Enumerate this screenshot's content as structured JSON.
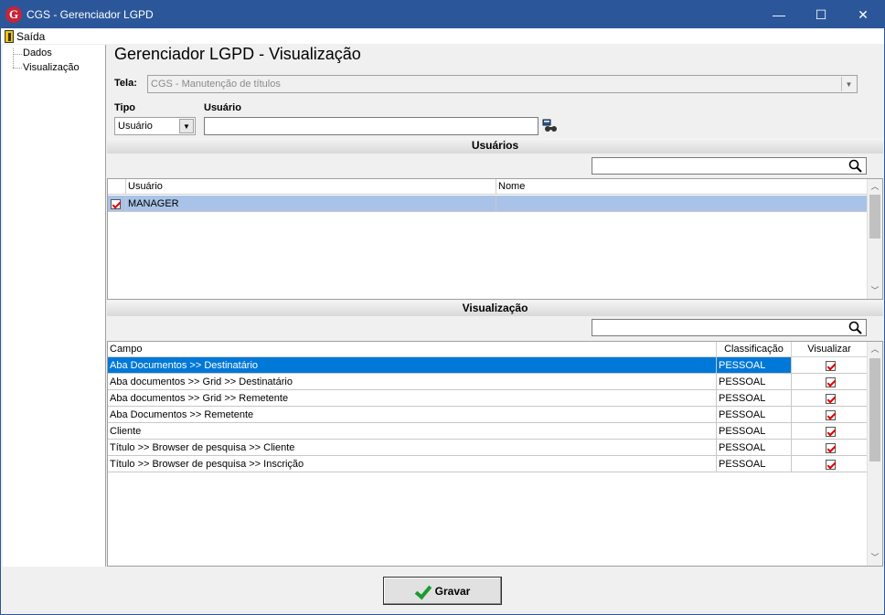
{
  "window": {
    "title": "CGS - Gerenciador LGPD",
    "controls": {
      "minimize": "—",
      "maximize": "☐",
      "close": "✕"
    }
  },
  "menu": {
    "exit_label": "Saída"
  },
  "tree": {
    "items": [
      {
        "label": "Dados"
      },
      {
        "label": "Visualização"
      }
    ]
  },
  "page": {
    "heading": "Gerenciador LGPD - Visualização"
  },
  "form": {
    "tela_label": "Tela:",
    "tela_value": "CGS - Manutenção de títulos",
    "tipo_label": "Tipo",
    "tipo_value": "Usuário",
    "usuario_label": "Usuário",
    "usuario_value": ""
  },
  "users_section": {
    "title": "Usuários",
    "search_value": "",
    "columns": [
      "Usuário",
      "Nome"
    ],
    "rows": [
      {
        "checked": true,
        "usuario": "MANAGER",
        "nome": ""
      }
    ]
  },
  "view_section": {
    "title": "Visualização",
    "search_value": "",
    "columns": [
      "Campo",
      "Classificação",
      "Visualizar"
    ],
    "rows": [
      {
        "campo": "Aba Documentos >> Destinatário",
        "classificacao": "PESSOAL",
        "visualizar": true
      },
      {
        "campo": "Aba documentos >> Grid  >> Destinatário",
        "classificacao": "PESSOAL",
        "visualizar": true
      },
      {
        "campo": "Aba documentos >> Grid  >> Remetente",
        "classificacao": "PESSOAL",
        "visualizar": true
      },
      {
        "campo": "Aba Documentos >> Remetente",
        "classificacao": "PESSOAL",
        "visualizar": true
      },
      {
        "campo": "Cliente",
        "classificacao": "PESSOAL",
        "visualizar": true
      },
      {
        "campo": "Título >> Browser de pesquisa >> Cliente",
        "classificacao": "PESSOAL",
        "visualizar": true
      },
      {
        "campo": "Título >> Browser de pesquisa >> Inscrição",
        "classificacao": "PESSOAL",
        "visualizar": true
      }
    ]
  },
  "buttons": {
    "save_label": "Gravar"
  },
  "colors": {
    "titlebar": "#2b579a",
    "selection": "#0078d7",
    "selection_light": "#a9c3e8",
    "check": "#d00000",
    "save_check": "#1c9b2e"
  }
}
